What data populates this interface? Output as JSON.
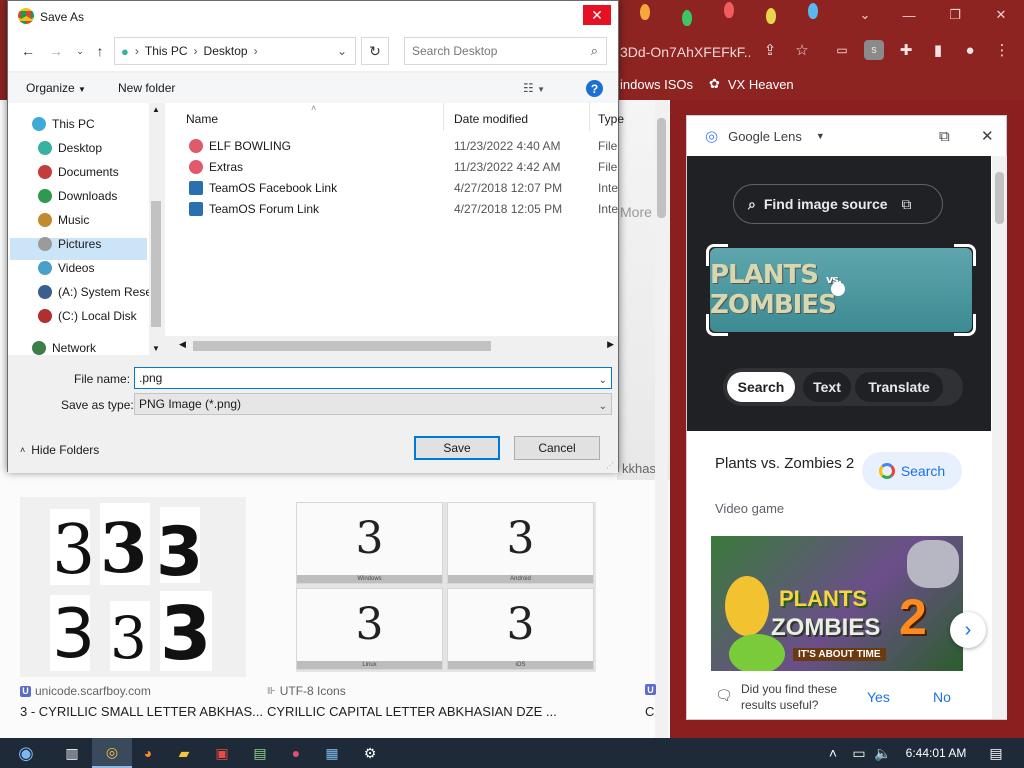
{
  "browser": {
    "address_fragment": "3Dd-On7AhXFEFkF...",
    "bookmarks": [
      "indows ISOs",
      "VX Heaven"
    ],
    "more_fragment": "More",
    "akhasi_fragment": "kkhasi"
  },
  "results": [
    {
      "source": "unicode.scarfboy.com",
      "title": "3 - CYRILLIC SMALL LETTER ABKHAS...",
      "icon_letter": "U"
    },
    {
      "source": "UTF-8 Icons",
      "title": "CYRILLIC CAPITAL LETTER ABKHASIAN DZE ...",
      "icon_letter": ""
    }
  ],
  "result_extra": {
    "icon_letter": "U",
    "title": "C"
  },
  "result2_captions": [
    "Windows",
    "Android",
    "Linux",
    "iOS"
  ],
  "glyph": "3",
  "lens": {
    "title": "Google Lens",
    "find_source": "Find image source",
    "banner_text_1": "PLANTS",
    "banner_vs": "vs.",
    "banner_text_2": "ZOMBIES",
    "chips": [
      "Search",
      "Text",
      "Translate"
    ],
    "game_title": "Plants vs. Zombies 2",
    "game_sub": "Video game",
    "search_btn": "Search",
    "image_logo": {
      "line1": "PLANTS",
      "line2": "ZOMBIES",
      "number": "2",
      "tagline": "IT'S ABOUT TIME"
    },
    "feedback_q": "Did you find these results useful?",
    "yes": "Yes",
    "no": "No"
  },
  "dialog": {
    "title": "Save As",
    "breadcrumb": [
      "This PC",
      "Desktop"
    ],
    "search_placeholder": "Search Desktop",
    "organize": "Organize",
    "new_folder": "New folder",
    "tree": [
      {
        "label": "This PC",
        "color": "#3fa9d8"
      },
      {
        "label": "Desktop",
        "color": "#37b1a2"
      },
      {
        "label": "Documents",
        "color": "#c43c3c"
      },
      {
        "label": "Downloads",
        "color": "#2f9a4f"
      },
      {
        "label": "Music",
        "color": "#c08a2f"
      },
      {
        "label": "Pictures",
        "color": "#9b9b9b"
      },
      {
        "label": "Videos",
        "color": "#4aa0c8"
      },
      {
        "label": "(A:) System Rese",
        "color": "#3a5f8f"
      },
      {
        "label": "(C:) Local Disk",
        "color": "#b03030"
      },
      {
        "label": "Network",
        "color": "#3c7d4a"
      }
    ],
    "columns": {
      "name": "Name",
      "date": "Date modified",
      "type": "Type"
    },
    "files": [
      {
        "name": "ELF BOWLING",
        "date": "11/23/2022 4:40 AM",
        "type": "File fo"
      },
      {
        "name": "Extras",
        "date": "11/23/2022 4:42 AM",
        "type": "File fo"
      },
      {
        "name": "TeamOS Facebook Link",
        "date": "4/27/2018 12:07 PM",
        "type": "Intern"
      },
      {
        "name": "TeamOS Forum Link",
        "date": "4/27/2018 12:05 PM",
        "type": "Intern"
      }
    ],
    "file_name_label": "File name:",
    "file_name_value": ".png",
    "save_type_label": "Save as type:",
    "save_type_value": "PNG Image (*.png)",
    "hide_folders": "Hide Folders",
    "save": "Save",
    "cancel": "Cancel"
  },
  "taskbar": {
    "time": "6:44:01 AM"
  }
}
